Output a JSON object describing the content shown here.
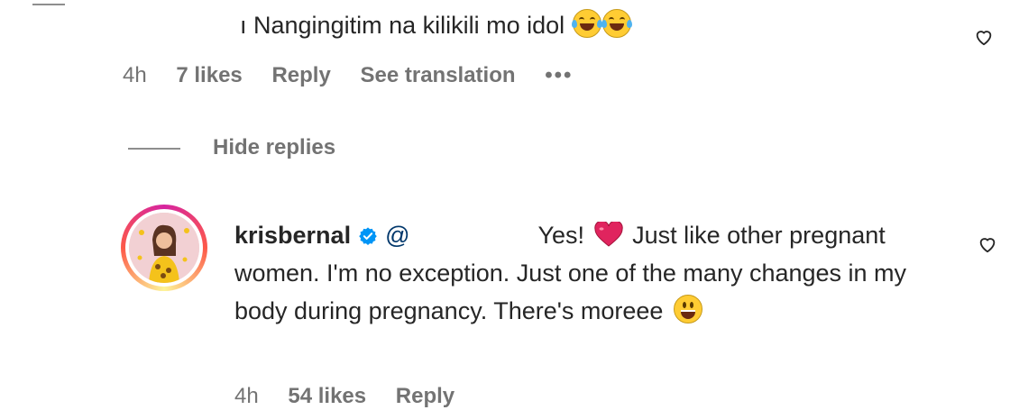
{
  "comment": {
    "text": "ı Nangingitim na kilikili mo idol",
    "emojis": [
      "face-with-tears-of-joy-icon",
      "face-with-tears-of-joy-icon"
    ],
    "time": "4h",
    "likes": "7 likes",
    "reply_label": "Reply",
    "translation_label": "See translation",
    "more_label": "•••"
  },
  "thread": {
    "hide_replies_label": "Hide replies"
  },
  "reply": {
    "username": "krisbernal",
    "verified": true,
    "mention": "@",
    "text_part1": "Yes!",
    "text_part2": "Just like other pregnant women. I'm no exception. Just one of the many changes in my body during pregnancy. There's moreee",
    "time": "4h",
    "likes": "54 likes",
    "reply_label": "Reply"
  },
  "colors": {
    "text": "#262626",
    "meta": "#737373",
    "mention": "#00376b",
    "verified": "#0095f6",
    "heart_emoji": "#e0245e"
  }
}
